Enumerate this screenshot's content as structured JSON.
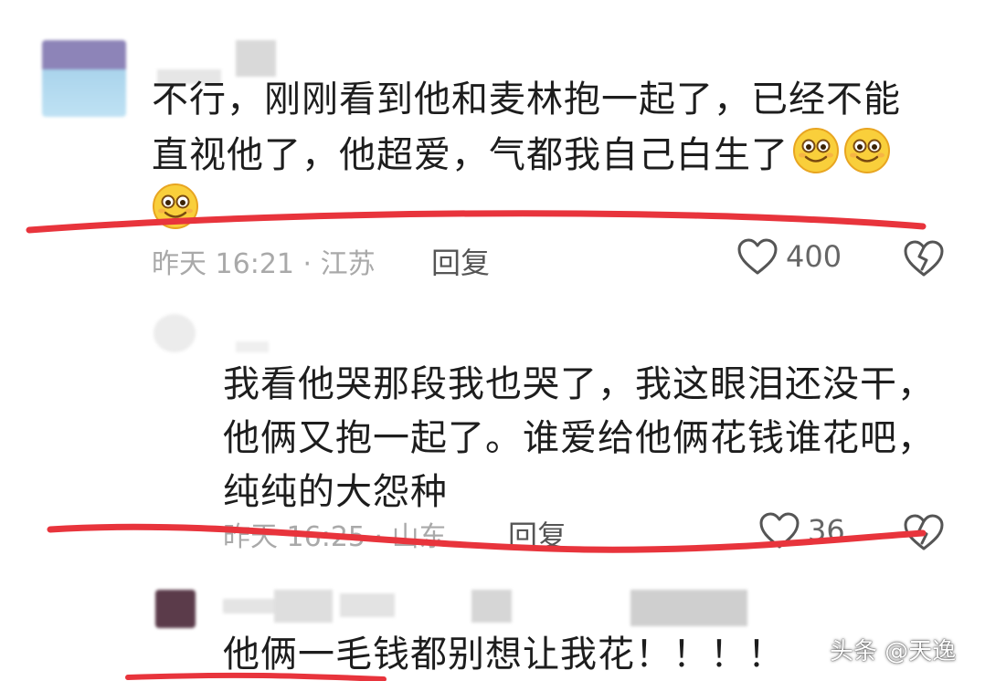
{
  "watermark": "头条 @天逸",
  "colors": {
    "underline": "#e8343c",
    "text": "#1d1d1d",
    "meta": "#a9a9a9"
  },
  "comments": [
    {
      "text_lines": [
        "不行，刚刚看到他和麦林抱一起了，已经不能",
        "直视他了，他超爱，气都我自己白生了"
      ],
      "emojis": [
        "grin-emoji",
        "grin-emoji",
        "grin-emoji"
      ],
      "time_location": "昨天 16:21 · 江苏",
      "reply_label": "回复",
      "likes": "400"
    },
    {
      "text_lines": [
        "我看他哭那段我也哭了，我这眼泪还没干，",
        "他俩又抱一起了。谁爱给他俩花钱谁花吧，",
        "纯纯的大怨种"
      ],
      "time_location": "昨天 16:25 · 山东",
      "reply_label": "回复",
      "likes": "36"
    },
    {
      "text_lines": [
        "他俩一毛钱都别想让我花！！！！"
      ]
    }
  ]
}
